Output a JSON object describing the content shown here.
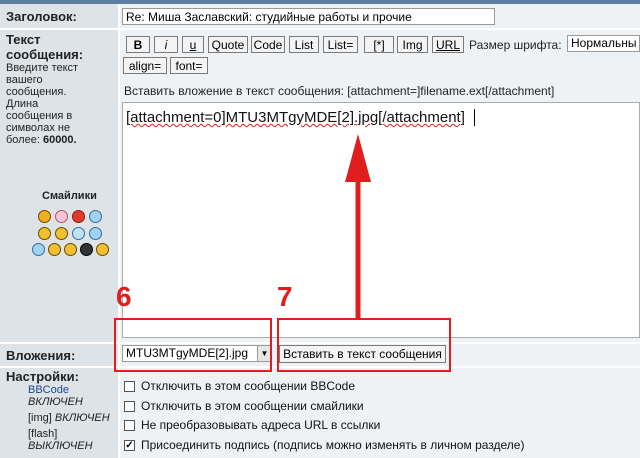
{
  "subject": {
    "label": "Заголовок:",
    "value": "Re: Миша Заславский: студийные работы и прочие"
  },
  "message": {
    "label_line1": "Текст",
    "label_line2": "сообщения:",
    "hint_line1": "Введите текст",
    "hint_line2": "вашего",
    "hint_line3": "сообщения.",
    "hint_line4": "Длина",
    "hint_line5": "сообщения в",
    "hint_line6": "символах не",
    "hint_line7": "более:",
    "hint_limit": "60000.",
    "body": "[attachment=0]MTU3MTgyMDE[2].jpg[/attachment]"
  },
  "smilies": {
    "title": "Смайлики"
  },
  "toolbar": {
    "bold": "B",
    "italic": "i",
    "underline": "u",
    "quote": "Quote",
    "code": "Code",
    "list": "List",
    "list_eq": "List=",
    "item": "[*]",
    "img": "Img",
    "url": "URL",
    "font_size_label": "Размер шрифта:",
    "font_size_value": "Нормальны",
    "align": "align=",
    "font": "font=",
    "insert_hint": "Вставить вложение в текст сообщения: [attachment=]filename.ext[/attachment]"
  },
  "attachments": {
    "label": "Вложения:",
    "selected_file": "MTU3MTgyMDE[2].jpg",
    "insert_button": "Вставить в текст сообщения"
  },
  "settings": {
    "label": "Настройки:",
    "bbcode_name": "BBCode",
    "bbcode_state": "ВКЛЮЧЕН",
    "img_name": "[img]",
    "img_state": "ВКЛЮЧЕН",
    "flash_name": "[flash]",
    "flash_state": "ВЫКЛЮЧЕН",
    "options": [
      "Отключить в этом сообщении BBCode",
      "Отключить в этом сообщении смайлики",
      "Не преобразовывать адреса URL в ссылки",
      "Присоединить подпись (подпись можно изменять в личном разделе)"
    ],
    "checked": [
      false,
      false,
      false,
      true
    ]
  },
  "annotations": {
    "step6": "6",
    "step7": "7"
  },
  "colors": {
    "annotation_red": "#e01e1e",
    "left_panel": "#dee3e7",
    "right_panel": "#eef2f5"
  }
}
